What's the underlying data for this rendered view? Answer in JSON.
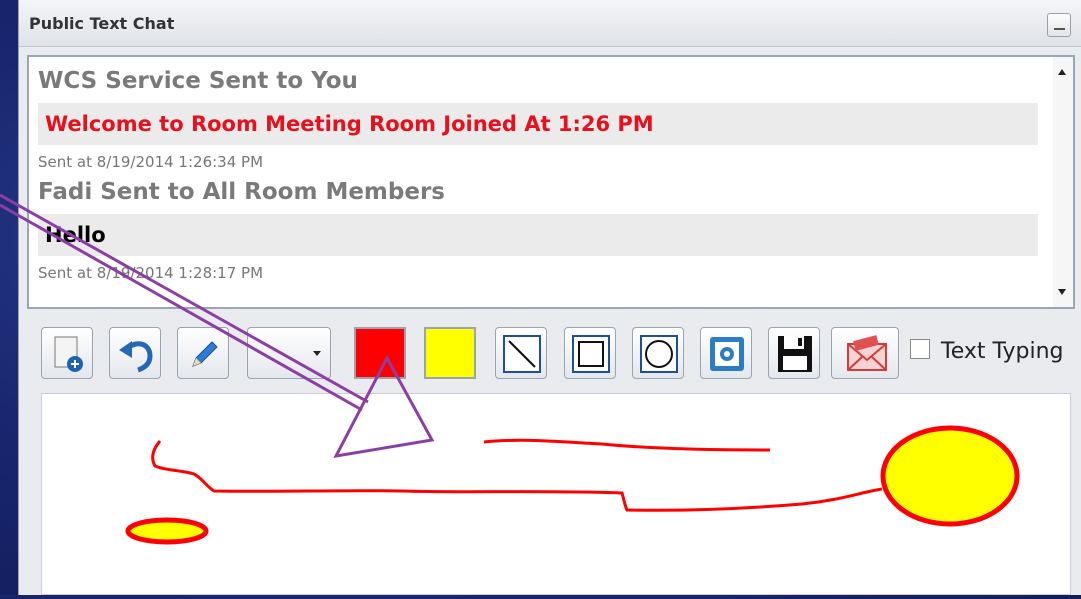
{
  "window": {
    "title": "Public Text Chat"
  },
  "chat": {
    "messages": [
      {
        "sender": "WCS Service Sent to You",
        "text": "Welcome to Room Meeting Room Joined At 1:26 PM",
        "text_color": "#e8101c",
        "timestamp": "Sent at 8/19/2014 1:26:34 PM"
      },
      {
        "sender": "Fadi Sent to All Room Members",
        "text": "Hello",
        "text_color": "#000000",
        "timestamp": "Sent at 8/19/2014 1:28:17 PM"
      }
    ]
  },
  "toolbar": {
    "tools": [
      {
        "name": "new-board-button",
        "icon": "page-add-icon"
      },
      {
        "name": "undo-button",
        "icon": "undo-icon"
      },
      {
        "name": "pencil-button",
        "icon": "pencil-icon"
      },
      {
        "name": "line-width-dropdown",
        "icon": "dropdown-icon"
      },
      {
        "name": "stroke-color-swatch",
        "color": "#ff0000"
      },
      {
        "name": "fill-color-swatch",
        "color": "#ffff00"
      },
      {
        "name": "line-tool-button",
        "icon": "line-icon"
      },
      {
        "name": "rectangle-tool-button",
        "icon": "rectangle-icon"
      },
      {
        "name": "ellipse-tool-button",
        "icon": "ellipse-icon"
      },
      {
        "name": "snapshot-button",
        "icon": "camera-icon"
      },
      {
        "name": "save-button",
        "icon": "floppy-disk-icon"
      },
      {
        "name": "send-button",
        "icon": "envelope-icon"
      }
    ],
    "text_typing_label": "Text Typing",
    "text_typing_checked": false
  },
  "colors": {
    "stroke": "#ff0000",
    "fill": "#ffff00",
    "annotation": "#8b3fa6"
  }
}
